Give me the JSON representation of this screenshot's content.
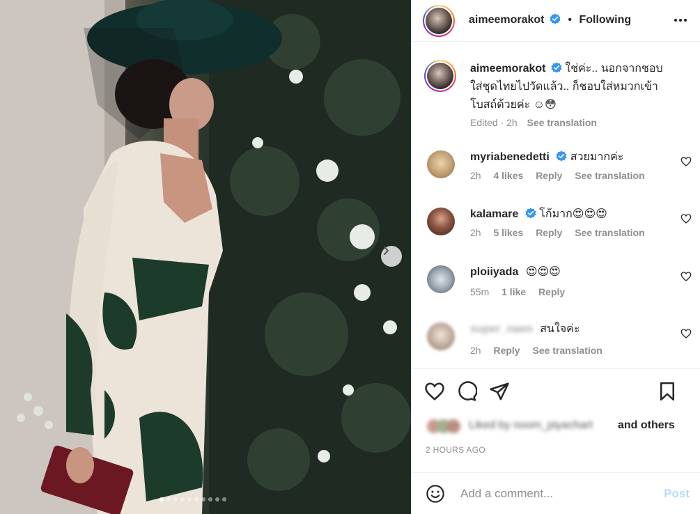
{
  "post": {
    "author": "aimeemorakot",
    "follow_status": "Following",
    "separator": "•",
    "caption_text": "ใช่ค่ะ.. นอกจากชอบใส่ชุดไทยไปวัดแล้ว.. ก็ชอบใส่หมวกเข้าโบสถ์ด้วยค่ะ ☺😳",
    "caption_meta": "Edited · 2h",
    "see_translation": "See translation",
    "carousel": {
      "current_slide": 1,
      "slide_count": 10
    }
  },
  "comments": [
    {
      "user": "myriabenedetti",
      "verified": true,
      "text": "สวยมากค่ะ",
      "time": "2h",
      "likes": "4 likes",
      "reply": "Reply",
      "translation": "See translation"
    },
    {
      "user": "kalamare",
      "verified": true,
      "text": "โก้มาก😍😍😍",
      "time": "2h",
      "likes": "5 likes",
      "reply": "Reply",
      "translation": "See translation"
    },
    {
      "user": "ploiiyada",
      "verified": false,
      "text": "😍😍😍",
      "time": "55m",
      "likes": "1 like",
      "reply": "Reply"
    },
    {
      "user": "super_naen",
      "verified": false,
      "text": "สนใจค่ะ",
      "time": "2h",
      "reply": "Reply",
      "translation": "See translation"
    }
  ],
  "likes": {
    "blurred_text": "Liked by noom_piyachart",
    "and_others": "and others"
  },
  "timestamp": "2 HOURS AGO",
  "add_comment": {
    "placeholder": "Add a comment...",
    "post_label": "Post"
  },
  "icons": [
    "more-icon",
    "verified-icon",
    "heart-icon",
    "comment-icon",
    "share-icon",
    "bookmark-icon",
    "emoji-icon",
    "chevron-right-icon"
  ],
  "colors": {
    "verified_blue": "#3897f0",
    "post_disabled": "#b3dbff",
    "muted": "#8e8e8e"
  }
}
